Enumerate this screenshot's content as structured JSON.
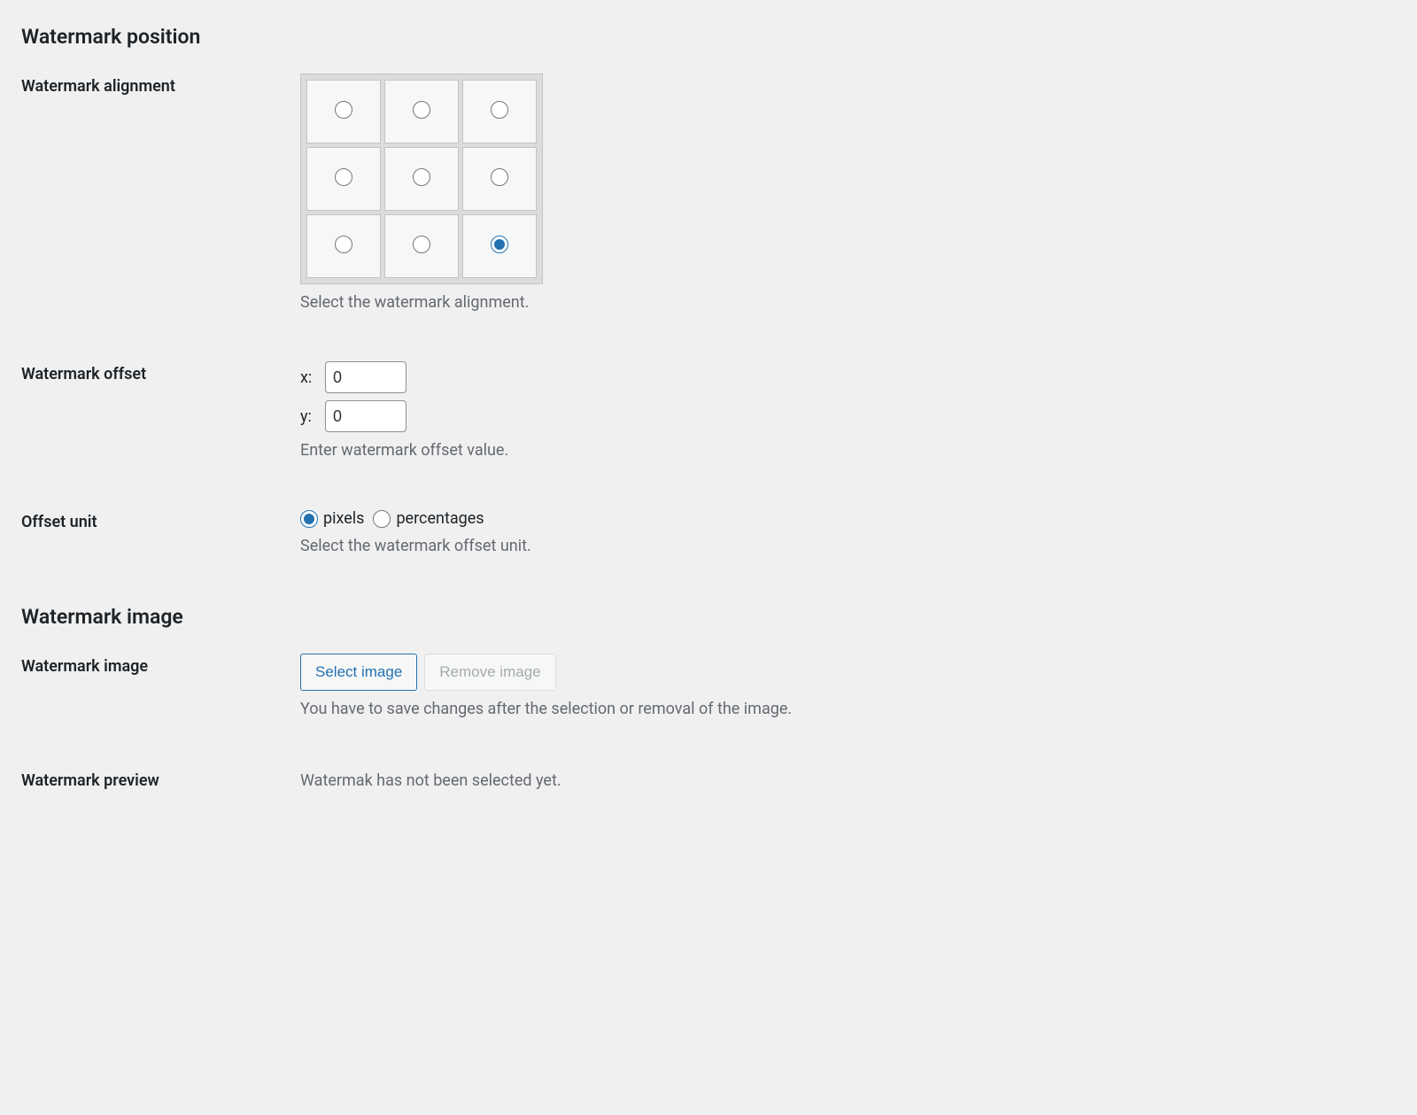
{
  "sections": {
    "position": {
      "heading": "Watermark position"
    },
    "image": {
      "heading": "Watermark image"
    }
  },
  "alignment": {
    "label": "Watermark alignment",
    "description": "Select the watermark alignment.",
    "selected": "bottom-right"
  },
  "offset": {
    "label": "Watermark offset",
    "x_label": "x:",
    "y_label": "y:",
    "x_value": "0",
    "y_value": "0",
    "description": "Enter watermark offset value."
  },
  "offset_unit": {
    "label": "Offset unit",
    "options": {
      "pixels": "pixels",
      "percentages": "percentages"
    },
    "selected": "pixels",
    "description": "Select the watermark offset unit."
  },
  "watermark_image": {
    "label": "Watermark image",
    "select_button": "Select image",
    "remove_button": "Remove image",
    "description": "You have to save changes after the selection or removal of the image."
  },
  "preview": {
    "label": "Watermark preview",
    "message": "Watermak has not been selected yet."
  }
}
